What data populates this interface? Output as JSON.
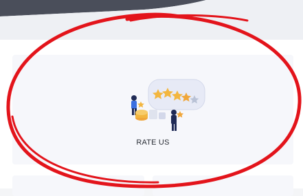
{
  "rate_card": {
    "label": "RATE US",
    "illustration_icon": "rating-stars-illustration"
  },
  "colors": {
    "annotation": "#e3141b",
    "card_bg": "#f6f7fb",
    "star": "#f3b63f",
    "star_grey": "#b9c2d6",
    "person_navy": "#1f2a55"
  }
}
